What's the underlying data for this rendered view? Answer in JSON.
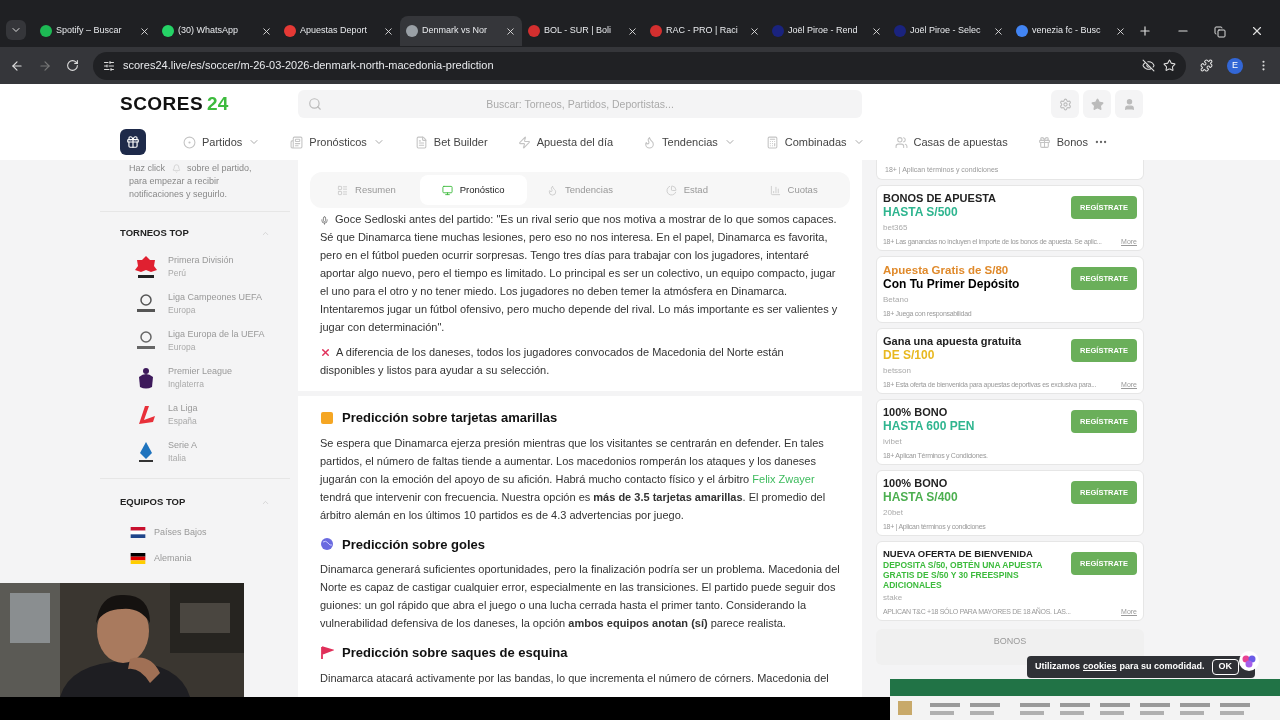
{
  "browser": {
    "tabs": [
      {
        "title": "Spotify – Buscar",
        "color": "#1db954",
        "selected": false
      },
      {
        "title": "(30) WhatsApp",
        "color": "#25d366",
        "selected": false
      },
      {
        "title": "Apuestas Deport",
        "color": "#e53935",
        "selected": false
      },
      {
        "title": "Denmark vs Nor",
        "color": "#9aa0a6",
        "selected": true
      },
      {
        "title": "BOL - SUR | Boli",
        "color": "#d32f2f",
        "selected": false
      },
      {
        "title": "RAC - PRO | Raci",
        "color": "#d32f2f",
        "selected": false
      },
      {
        "title": "Joël Piroe - Rend",
        "color": "#1a237e",
        "selected": false
      },
      {
        "title": "Joël Piroe - Selec",
        "color": "#1a237e",
        "selected": false
      },
      {
        "title": "venezia fc - Busc",
        "color": "#4285f4",
        "selected": false
      }
    ],
    "url": "scores24.live/es/soccer/m-26-03-2026-denmark-north-macedonia-prediction",
    "profile": "E"
  },
  "site": {
    "logo": "SCORES",
    "logo_number": "24",
    "search_placeholder": "Buscar: Torneos, Partidos, Deportistas...",
    "nav": [
      {
        "label": "Partidos",
        "caret": true
      },
      {
        "label": "Pronósticos",
        "caret": true
      },
      {
        "label": "Bet Builder",
        "caret": false
      },
      {
        "label": "Apuesta del día",
        "caret": false
      },
      {
        "label": "Tendencias",
        "caret": true
      },
      {
        "label": "Combinadas",
        "caret": true
      },
      {
        "label": "Casas de apuestas",
        "caret": false
      },
      {
        "label": "Bonos",
        "caret": false
      }
    ]
  },
  "sidebar": {
    "notice": [
      "Haz click",
      "sobre el partido, para empezar a recibir notificaciones y seguirlo."
    ],
    "tournaments_title": "TORNEOS TOP",
    "tournaments": [
      {
        "name": "Primera División",
        "country": "Perú",
        "kind": "liga1"
      },
      {
        "name": "Liga Campeones UEFA",
        "country": "Europa",
        "kind": "ucl"
      },
      {
        "name": "Liga Europa de la UEFA",
        "country": "Europa",
        "kind": "uel"
      },
      {
        "name": "Premier League",
        "country": "Inglaterra",
        "kind": "epl"
      },
      {
        "name": "La Liga",
        "country": "España",
        "kind": "laliga"
      },
      {
        "name": "Serie A",
        "country": "Italia",
        "kind": "seriea"
      }
    ],
    "teams_title": "EQUIPOS TOP",
    "teams": [
      {
        "name": "Países Bajos",
        "kind": "nl"
      },
      {
        "name": "Alemania",
        "kind": "de"
      }
    ]
  },
  "main": {
    "tabs": [
      {
        "label": "Resumen",
        "selected": false
      },
      {
        "label": "Pronóstico",
        "selected": true
      },
      {
        "label": "Tendencias",
        "selected": false
      },
      {
        "label": "Estad",
        "selected": false
      },
      {
        "label": "Cuotas",
        "selected": false
      }
    ],
    "intro": [
      {
        "kind": "quote",
        "segments": [
          {
            "text": "Goce Sedloski antes del partido: \"Es un rival serio que nos motiva a mostrar de lo que somos capaces. Sé que Dinamarca tiene muchas lesiones, pero eso no nos interesa. En el papel, Dinamarca es favorita, pero en el fútbol pueden ocurrir sorpresas. Tengo tres días para trabajar con los jugadores, intentaré aportar algo nuevo, pero el tiempo es limitado. Lo principal es ser un colectivo, un equipo compacto, jugar el uno para el otro y no tener miedo. Los jugadores no deben temer la atmósfera en Dinamarca. Intentaremos jugar un fútbol ofensivo, pero mucho depende del rival. Lo más importante es ser valientes y jugar con determinación\"."
          }
        ]
      },
      {
        "kind": "cross",
        "segments": [
          {
            "text": "A diferencia de los daneses, todos los jugadores convocados de Macedonia del Norte están disponibles y listos para ayudar a su selección."
          }
        ]
      }
    ],
    "sections": [
      {
        "kind": "card",
        "heading": "Predicción sobre tarjetas amarillas",
        "segments": [
          {
            "text": "Se espera que Dinamarca ejerza presión mientras que los visitantes se centrarán en defender. En tales partidos, el número de faltas tiende a aumentar. Los macedonios romperán los ataques y los daneses jugarán con la emoción del apoyo de su afición. Habrá mucho contacto físico y el árbitro "
          },
          {
            "link": "Felix Zwayer"
          },
          {
            "text": " tendrá que intervenir con frecuencia. Nuestra opción es **más de 3.5 tarjetas amarillas**. El promedio del árbitro alemán en los últimos 10 partidos es de 4.3 advertencias por juego."
          }
        ]
      },
      {
        "kind": "ball",
        "heading": "Predicción sobre goles",
        "segments": [
          {
            "text": "Dinamarca generará suficientes oportunidades, pero la finalización podría ser un problema. Macedonia del Norte es capaz de castigar cualquier error, especialmente en las transiciones. El partido puede seguir dos guiones: un gol rápido que abra el juego o una lucha cerrada hasta el primer tanto. Considerando la vulnerabilidad defensiva de los daneses, la opción **ambos equipos anotan (sí)** parece realista."
          }
        ]
      },
      {
        "kind": "flag",
        "heading": "Predicción sobre saques de esquina",
        "segments": [
          {
            "text": "Dinamarca atacará activamente por las bandas, lo que incrementa el número de córners. Macedonia del"
          }
        ]
      }
    ]
  },
  "offers": [
    {
      "kind": "cut",
      "terms": "18+ | Aplican términos y condiciones"
    },
    {
      "kind": "plain_first",
      "line1": "BONOS DE APUESTA",
      "line2": "HASTA S/500",
      "color": "#2fb58f",
      "brand": "bet365",
      "terms": "18+ Las ganancias no incluyen el importe de los bonos de apuesta. Se aplic...",
      "more": "More",
      "button": "REGÍSTRATE"
    },
    {
      "kind": "highlight_first",
      "line1": "Apuesta Gratis de S/80",
      "line2": "Con Tu Primer Depósito",
      "color": "#e08a2b",
      "brand": "Betano",
      "terms": "18+ Juega con responsabilidad",
      "button": "REGÍSTRATE"
    },
    {
      "kind": "plain_first",
      "line1": "Gana una apuesta gratuita",
      "line2": "DE S/100",
      "color": "#e8b820",
      "brand": "betsson",
      "terms": "18+ Esta oferta de bienvenida para apuestas deportivas es exclusiva para...",
      "more": "More",
      "button": "REGÍSTRATE"
    },
    {
      "kind": "plain_first",
      "line1": "100% BONO",
      "line2": "HASTA 600 PEN",
      "color": "#2fb58f",
      "brand": "ivibet",
      "terms": "18+ Aplican Términos y Condiciones.",
      "button": "REGÍSTRATE"
    },
    {
      "kind": "plain_first",
      "line1": "100% BONO",
      "line2": "HASTA S/400",
      "color": "#4caf50",
      "brand": "20bet",
      "terms": "18+ | Aplican términos y condiciones",
      "button": "REGÍSTRATE"
    },
    {
      "kind": "small",
      "line1": "NUEVA OFERTA DE BIENVENIDA",
      "line2": "DEPOSITA S/50, OBTÉN UNA APUESTA GRATIS DE S/50 Y 30 FREESPINS ADICIONALES",
      "color": "#3dbb3d",
      "brand": "stake",
      "terms": "APLICAN T&C +18 SÓLO PARA MAYORES DE 18 AÑOS. LAS...",
      "more": "More",
      "button": "REGÍSTRATE"
    }
  ],
  "offers_more": "BONOS",
  "cookie": {
    "before": "Utilizamos",
    "link": "cookies",
    "after": "para su comodidad.",
    "button": "OK"
  }
}
